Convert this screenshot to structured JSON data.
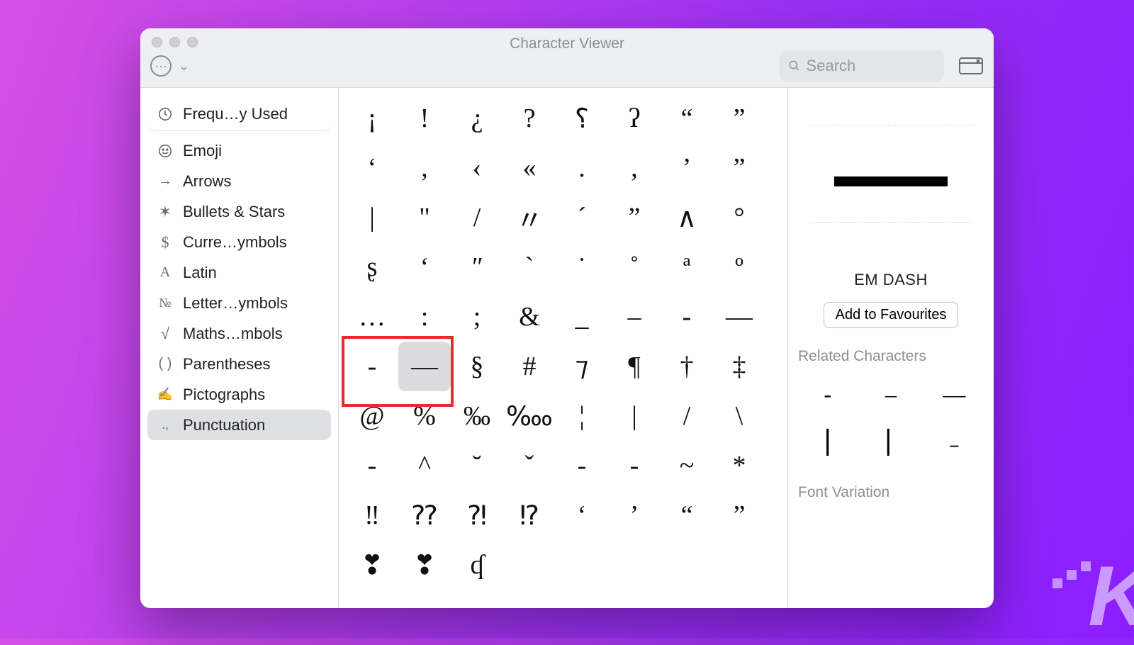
{
  "window": {
    "title": "Character Viewer"
  },
  "toolbar": {
    "search_placeholder": "Search"
  },
  "sidebar": {
    "items": [
      {
        "icon": "clock",
        "label": "Frequ…y Used"
      },
      {
        "icon": "smile",
        "label": "Emoji"
      },
      {
        "icon": "arrow",
        "label": "Arrows"
      },
      {
        "icon": "star",
        "label": "Bullets & Stars"
      },
      {
        "icon": "dollar",
        "label": "Curre…ymbols"
      },
      {
        "icon": "latin",
        "label": "Latin"
      },
      {
        "icon": "numero",
        "label": "Letter…ymbols"
      },
      {
        "icon": "sqrt",
        "label": "Maths…mbols"
      },
      {
        "icon": "paren",
        "label": "Parentheses"
      },
      {
        "icon": "picto",
        "label": "Pictographs"
      },
      {
        "icon": "punct",
        "label": "Punctuation"
      }
    ],
    "active_index": 10
  },
  "grid": {
    "chars": [
      "¡",
      "!",
      "¿",
      "?",
      "⸮",
      "ʔ",
      "“",
      "”",
      "‘",
      ",",
      "‹",
      "«",
      ".",
      ",",
      "’",
      "”",
      "|",
      "\"",
      "/",
      "〃",
      "ˊ",
      "ˮ",
      "∧",
      "°",
      "ʂ",
      "‘",
      "ʺ",
      "ˋ",
      "˙",
      "˚",
      "ª",
      "º",
      "…",
      ":",
      ";",
      "&",
      "_",
      "–",
      "-",
      "—",
      "-",
      "—",
      "§",
      "#",
      "⁊",
      "¶",
      "†",
      "‡",
      "@",
      "%",
      "‰",
      "‱",
      "¦",
      "|",
      "/",
      "\\",
      "-",
      "^",
      "˘",
      "ˇ",
      "-",
      "-",
      "~",
      "*",
      "‼",
      "⁇",
      "⁈",
      "⁉",
      "‘",
      "’",
      "“",
      "”",
      "❣",
      "❣",
      "ʠ",
      "",
      "",
      "",
      "",
      ""
    ],
    "selected_index": 41,
    "highlight_cells": [
      40,
      41
    ]
  },
  "detail": {
    "name": "EM DASH",
    "fav_label": "Add to Favourites",
    "related_header": "Related Characters",
    "related": [
      "-",
      "–",
      "—",
      "⎮",
      "⎢",
      "﹣"
    ],
    "font_variation_header": "Font Variation"
  }
}
